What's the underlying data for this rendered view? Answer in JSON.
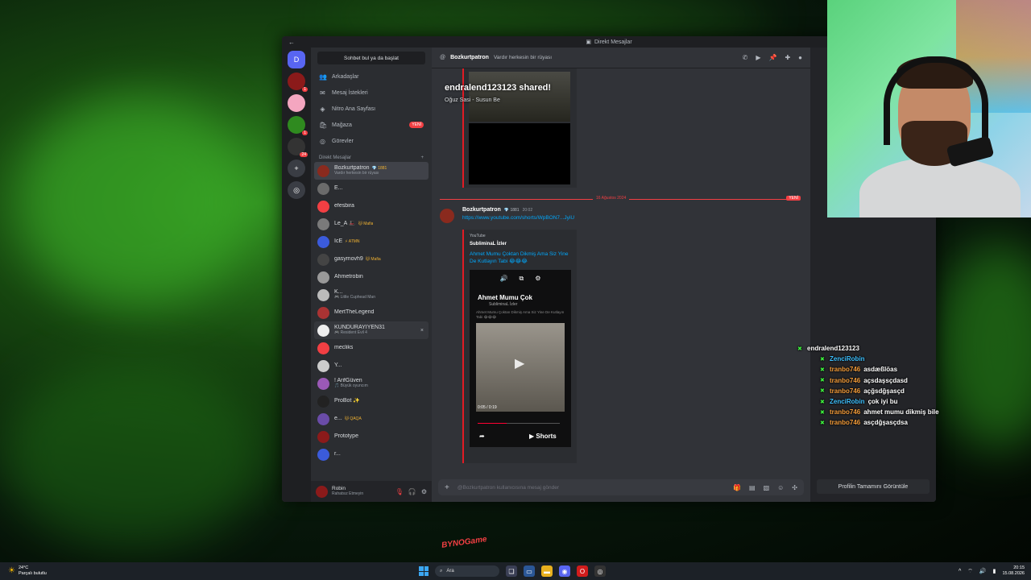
{
  "window": {
    "title": "Direkt Mesajlar"
  },
  "sidebar": {
    "search_label": "Sohbet bul ya da başlat",
    "nav": [
      {
        "label": "Arkadaşlar",
        "icon": "friends-icon"
      },
      {
        "label": "Mesaj İstekleri",
        "icon": "mail-icon"
      },
      {
        "label": "Nitro Ana Sayfası",
        "icon": "nitro-icon"
      },
      {
        "label": "Mağaza",
        "icon": "shop-icon",
        "badge": "YENİ"
      },
      {
        "label": "Görevler",
        "icon": "quests-icon"
      }
    ],
    "dm_header": "Direkt Mesajlar",
    "dms": [
      {
        "name": "Bozkurtpatron",
        "tag": "💎 1881",
        "sub": "Vardır herkesin bir rüyası",
        "color": "#8a2a1e",
        "active": true
      },
      {
        "name": "E...",
        "tag": "",
        "sub": "",
        "color": "#6b6b6b"
      },
      {
        "name": "efesbira",
        "tag": "",
        "sub": "",
        "color": "#f23f43"
      },
      {
        "name": "Le_A 🎩",
        "tag": "🐱 Mafia",
        "sub": "",
        "color": "#7a7a7a"
      },
      {
        "name": "IcE",
        "tag": "⚡ ATMN",
        "sub": "",
        "color": "#3b5bdb"
      },
      {
        "name": "gasymovh9",
        "tag": "🐱 Mafia",
        "sub": "",
        "color": "#444"
      },
      {
        "name": "Ahmetrobin",
        "tag": "",
        "sub": "",
        "color": "#999"
      },
      {
        "name": "K...",
        "tag": "",
        "sub": "🎮 Little Cuphead Man",
        "color": "#bbb"
      },
      {
        "name": "MertTheLegend",
        "tag": "",
        "sub": "",
        "color": "#a33"
      },
      {
        "name": "KUNDURAYİYEN31",
        "tag": "",
        "sub": "🎮 Resident Evil 4",
        "color": "#eee",
        "hover": true
      },
      {
        "name": "mecliks",
        "tag": "",
        "sub": "",
        "color": "#f23f43"
      },
      {
        "name": "Y...",
        "tag": "",
        "sub": "",
        "color": "#ccc"
      },
      {
        "name": "! ArifGüven",
        "tag": "",
        "sub": "🎵 Büyük oyuncım",
        "color": "#9b59b6"
      },
      {
        "name": "ProBot ✨",
        "tag": "",
        "sub": "",
        "color": "#222"
      },
      {
        "name": "e...",
        "tag": "🐱 QAQA",
        "sub": "",
        "color": "#6a4ca8"
      },
      {
        "name": "Prototype",
        "tag": "",
        "sub": "",
        "color": "#8b1a1a"
      },
      {
        "name": "r...",
        "tag": "",
        "sub": "",
        "color": "#3b5bdb"
      }
    ],
    "user": {
      "name": "Robin",
      "status": "Rahatsız Etmeyin"
    }
  },
  "servers": [
    {
      "label": "D",
      "badge": ""
    },
    {
      "label": "",
      "badge": "1",
      "color": "#8b1a1a"
    },
    {
      "label": "",
      "badge": "",
      "color": "#f4a6c0"
    },
    {
      "label": "",
      "badge": "1",
      "color": "#2f8a1f"
    },
    {
      "label": "",
      "badge": "24",
      "color": "#333"
    },
    {
      "label": "+",
      "badge": ""
    },
    {
      "label": "◎",
      "badge": ""
    }
  ],
  "chat": {
    "header_name": "Bozkurtpatron",
    "header_status": "Vardır herkesin bir rüyası",
    "shared_overlay": "endralend123123 shared!",
    "shared_sub": "Oğuz Sasi - Susun Be",
    "date_divider": "16 Ağustos 2024",
    "new_label": "YENİ",
    "message": {
      "author": "Bozkurtpatron",
      "tag": "💎 1881",
      "time": "20:02",
      "link": "https://www.youtube.com/shorts/WpBON7...JyiU"
    },
    "embed": {
      "provider": "YouTube",
      "author": "SubliminaL İzler",
      "title": "Ahmet Mumu Çoktan Dikmiş Ama Siz Yine De Kutlayın Tabi 😂😂😂",
      "player_channel": "Ahmet Mumu Çok",
      "player_channel_sub": "SubliminaL İzler",
      "player_desc": "Ahmet Mumu Çoktan Dikmiş Ama Siz Yine De Kutlayın Tabi 😂😂😂",
      "time": "0:05 / 0:19",
      "progress": 0.35,
      "shorts_label": "Shorts"
    },
    "composer_placeholder": "@Bozkurtpatron kullanıcısına mesaj gönder"
  },
  "profile": {
    "button_label": "Profilin Tamamını Görüntüle"
  },
  "stream_chat": [
    {
      "user": "endralend123123",
      "msg": "",
      "color": "#ffffff",
      "indent": false
    },
    {
      "user": "ZenciRobin",
      "msg": "",
      "color": "#3ec1ff",
      "indent": true
    },
    {
      "user": "tranbo746",
      "msg": "asdæßlöas",
      "color": "#f39c3a",
      "indent": true
    },
    {
      "user": "tranbo746",
      "msg": "açsdaşsçdasd",
      "color": "#f39c3a",
      "indent": true
    },
    {
      "user": "tranbo746",
      "msg": "açğsdğşasçd",
      "color": "#f39c3a",
      "indent": true
    },
    {
      "user": "ZenciRobin",
      "msg": "çok iyi bu",
      "color": "#3ec1ff",
      "indent": true
    },
    {
      "user": "tranbo746",
      "msg": "ahmet mumu dikmiş bile",
      "color": "#f39c3a",
      "indent": true
    },
    {
      "user": "tranbo746",
      "msg": "asçdğşasçdsa",
      "color": "#f39c3a",
      "indent": true
    }
  ],
  "watermark": "BYNOGame",
  "taskbar": {
    "weather_temp": "24°C",
    "weather_text": "Parçalı bulutlu",
    "search_label": "Ara",
    "time": "20:15",
    "date": "15.08.2026"
  }
}
